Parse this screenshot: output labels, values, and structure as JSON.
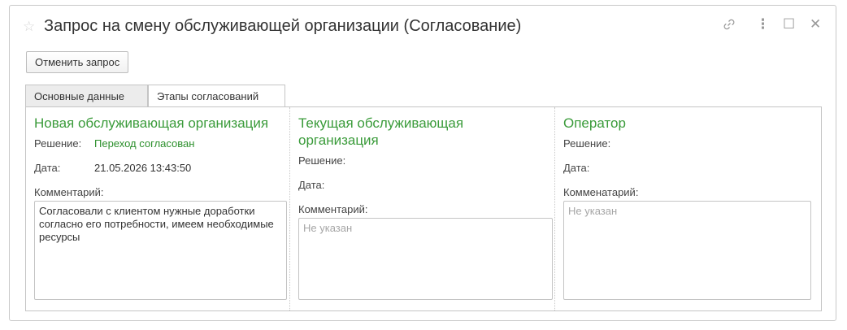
{
  "window": {
    "title": "Запрос на смену обслуживающей организации (Согласование)",
    "star_icon": "☆",
    "link_icon": "🔗",
    "more_icon": "⋮",
    "maximize_icon": "☐",
    "close_icon": "✕"
  },
  "toolbar": {
    "cancel_label": "Отменить запрос"
  },
  "tabs": [
    {
      "label": "Основные данные",
      "active": false
    },
    {
      "label": "Этапы согласований",
      "active": true
    }
  ],
  "columns": {
    "new_org": {
      "heading": "Новая обслуживающая организация",
      "decision_label": "Решение:",
      "decision_value": "Переход согласован",
      "date_label": "Дата:",
      "date_value": "21.05.2026 13:43:50",
      "comment_label": "Комментарий:",
      "comment_value": "Согласовали с клиентом нужные доработки согласно его потребности, имеем необходимые ресурсы"
    },
    "current_org": {
      "heading": "Текущая обслуживающая организация",
      "decision_label": "Решение:",
      "date_label": "Дата:",
      "comment_label": "Комментарий:",
      "comment_placeholder": "Не указан"
    },
    "operator": {
      "heading": "Оператор",
      "decision_label": "Решение:",
      "date_label": "Дата:",
      "comment_label": "Комменатарий:",
      "comment_placeholder": "Не указан"
    }
  },
  "colors": {
    "heading": "#3a9b3a",
    "decision_value": "#2b8f2b",
    "placeholder": "#a6a6a6"
  }
}
